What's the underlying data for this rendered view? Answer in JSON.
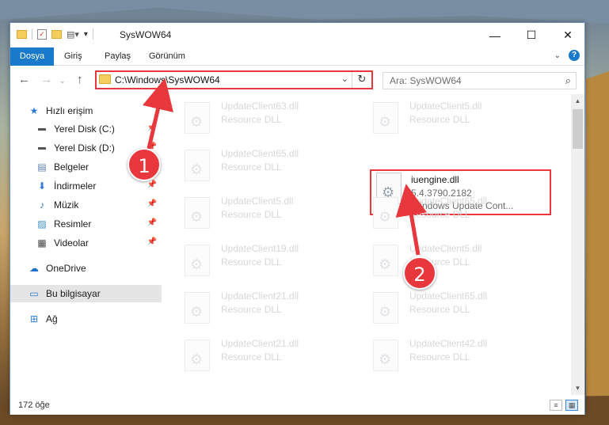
{
  "window": {
    "title": "SysWOW64"
  },
  "ribbon": {
    "tabs": [
      "Dosya",
      "Giriş",
      "Paylaş",
      "Görünüm"
    ],
    "help": "?"
  },
  "nav": {
    "back": "←",
    "forward": "→",
    "up": "↑",
    "address": "C:\\Windows\\SysWOW64",
    "search_placeholder": "Ara: SysWOW64"
  },
  "sidebar": {
    "items": [
      {
        "label": "Hızlı erişim"
      },
      {
        "label": "Yerel Disk (C:)"
      },
      {
        "label": "Yerel Disk (D:)"
      },
      {
        "label": "Belgeler"
      },
      {
        "label": "İndirmeler"
      },
      {
        "label": "Müzik"
      },
      {
        "label": "Resimler"
      },
      {
        "label": "Videolar"
      },
      {
        "label": "OneDrive"
      },
      {
        "label": "Bu bilgisayar"
      },
      {
        "label": "Ağ"
      }
    ]
  },
  "files": [
    {
      "name": "UpdateClient63.dll",
      "type": "Resource DLL"
    },
    {
      "name": "UpdateClient5.dll",
      "type": "Resource DLL"
    },
    {
      "name": "UpdateClient65.dll",
      "type": "Resource DLL"
    },
    {
      "name": "iuengine.dll",
      "version": "5.4.3790.2182",
      "desc": "Windows Update Cont..."
    },
    {
      "name": "UpdateClient5.dll",
      "type": "Resource DLL"
    },
    {
      "name": "UpdateClient65.dll",
      "type": "Resource DLL"
    },
    {
      "name": "UpdateClient19.dll",
      "type": "Resource DLL"
    },
    {
      "name": "UpdateClient5.dll",
      "type": "Resource DLL"
    },
    {
      "name": "UpdateClient21.dll",
      "type": "Resource DLL"
    },
    {
      "name": "UpdateClient65.dll",
      "type": "Resource DLL"
    },
    {
      "name": "UpdateClient21.dll",
      "type": "Resource DLL"
    },
    {
      "name": "UpdateClient42.dll",
      "type": "Resource DLL"
    }
  ],
  "status": {
    "count": "172 öğe"
  },
  "annotations": {
    "badge1": "1",
    "badge2": "2"
  },
  "colors": {
    "accent": "#1979ca",
    "highlight": "#e8383d"
  }
}
